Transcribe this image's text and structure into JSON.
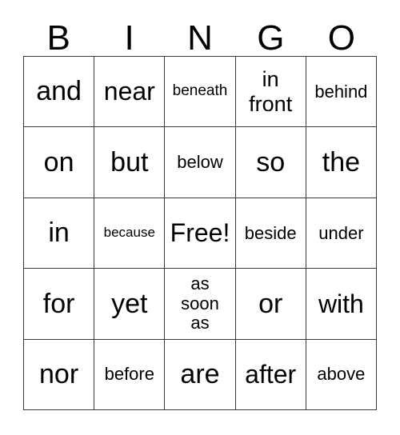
{
  "card": {
    "title_letters": [
      "B",
      "I",
      "N",
      "G",
      "O"
    ],
    "free_space_label": "Free!",
    "grid_line_color": "#3a3a3a",
    "background_color": "#ffffff",
    "text_color": "#000000",
    "rows": 5,
    "columns": 5,
    "cells": [
      [
        {
          "text": "and",
          "size": "fs-xl",
          "lines": 1
        },
        {
          "text": "near",
          "size": "fs-lg",
          "lines": 1
        },
        {
          "text": "beneath",
          "size": "fs-xs",
          "lines": 1
        },
        {
          "text": "in\nfront",
          "size": "fs-md",
          "lines": 2
        },
        {
          "text": "behind",
          "size": "fs-sm",
          "lines": 1
        }
      ],
      [
        {
          "text": "on",
          "size": "fs-xl",
          "lines": 1
        },
        {
          "text": "but",
          "size": "fs-xl",
          "lines": 1
        },
        {
          "text": "below",
          "size": "fs-sm",
          "lines": 1
        },
        {
          "text": "so",
          "size": "fs-xl",
          "lines": 1
        },
        {
          "text": "the",
          "size": "fs-xl",
          "lines": 1
        }
      ],
      [
        {
          "text": "in",
          "size": "fs-xl",
          "lines": 1
        },
        {
          "text": "because",
          "size": "fs-xxs",
          "lines": 1
        },
        {
          "text": "Free!",
          "size": "fs-lg",
          "lines": 1
        },
        {
          "text": "beside",
          "size": "fs-sm",
          "lines": 1
        },
        {
          "text": "under",
          "size": "fs-sm",
          "lines": 1
        }
      ],
      [
        {
          "text": "for",
          "size": "fs-xl",
          "lines": 1
        },
        {
          "text": "yet",
          "size": "fs-xl",
          "lines": 1
        },
        {
          "text": "as\nsoon\nas",
          "size": "fs-sm",
          "lines": 3
        },
        {
          "text": "or",
          "size": "fs-xl",
          "lines": 1
        },
        {
          "text": "with",
          "size": "fs-lg",
          "lines": 1
        }
      ],
      [
        {
          "text": "nor",
          "size": "fs-xl",
          "lines": 1
        },
        {
          "text": "before",
          "size": "fs-sm",
          "lines": 1
        },
        {
          "text": "are",
          "size": "fs-xl",
          "lines": 1
        },
        {
          "text": "after",
          "size": "fs-lg",
          "lines": 1
        },
        {
          "text": "above",
          "size": "fs-sm",
          "lines": 1
        }
      ]
    ]
  }
}
